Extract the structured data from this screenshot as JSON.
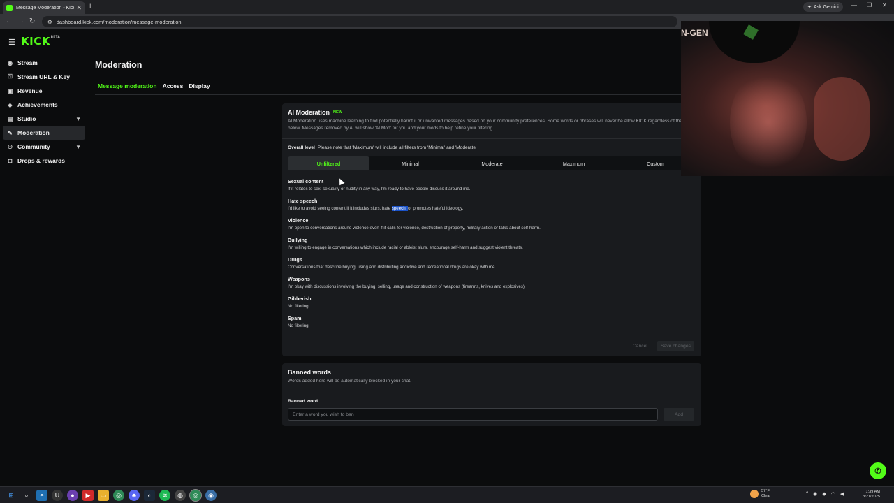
{
  "browser": {
    "tab_title": "Message Moderation - Kick Da",
    "new_tab": "+",
    "url": "dashboard.kick.com/moderation/message-moderation",
    "gemini_label": "Ask Gemini"
  },
  "app": {
    "brand": "KICK",
    "brand_tag": "BETA"
  },
  "sidebar": {
    "items": [
      {
        "label": "Stream",
        "icon": "broadcast-icon"
      },
      {
        "label": "Stream URL & Key",
        "icon": "link-icon"
      },
      {
        "label": "Revenue",
        "icon": "revenue-icon"
      },
      {
        "label": "Achievements",
        "icon": "achievements-icon"
      },
      {
        "label": "Studio",
        "icon": "studio-icon"
      },
      {
        "label": "Moderation",
        "icon": "wrench-icon"
      },
      {
        "label": "Community",
        "icon": "community-icon"
      },
      {
        "label": "Drops & rewards",
        "icon": "gift-icon"
      }
    ]
  },
  "page": {
    "title": "Moderation",
    "tabs": [
      "Message moderation",
      "Access",
      "Display"
    ]
  },
  "ai_moderation": {
    "title": "AI Moderation",
    "badge": "NEW",
    "description": "AI Moderation uses machine learning to find potentially harmful or unwanted messages based on your community preferences. Some words or phrases will never be allow KICK regardless of the settings below. Messages removed by AI will show 'AI Mod' for you and your mods to help refine your filtering.",
    "overall_label": "Overall level",
    "overall_note": "Please note that 'Maximum' will include all filters from 'Minimal' and 'Moderate'",
    "levels": [
      "Unfiltered",
      "Minimal",
      "Moderate",
      "Maximum",
      "Custom"
    ],
    "selected_level": "Unfiltered",
    "categories": [
      {
        "title": "Sexual content",
        "desc": "If it relates to sex, sexuality or nudity in any way, I'm ready to have people discuss it around me."
      },
      {
        "title": "Hate speech",
        "desc_pre": "I'd like to avoid seeing content if it includes slurs, hate ",
        "desc_hl": "speech, ",
        "desc_post": "or promotes hateful ideology."
      },
      {
        "title": "Violence",
        "desc": "I'm open to conversations around violence even if it calls for violence, destruction of property, military action or talks about self-harm."
      },
      {
        "title": "Bullying",
        "desc": "I'm willing to engage in conversations which include racial or ableist slurs, encourage self-harm and suggest violent threats."
      },
      {
        "title": "Drugs",
        "desc": "Conversations that describe buying, using and distributing addictive and recreational drugs are okay with me."
      },
      {
        "title": "Weapons",
        "desc": "I'm okay with discussions involving the buying, selling, usage and construction of weapons (firearms, knives and explosives)."
      },
      {
        "title": "Gibberish",
        "desc": "No filtering"
      },
      {
        "title": "Spam",
        "desc": "No filtering"
      }
    ],
    "cancel_label": "Cancel",
    "save_label": "Save changes"
  },
  "banned_words": {
    "title": "Banned words",
    "description": "Words added here will be automatically blocked in your chat.",
    "field_label": "Banned word",
    "placeholder": "Enter a word you wish to ban",
    "add_label": "Add"
  },
  "webcam": {
    "wall_text": "N-GEN"
  },
  "taskbar": {
    "weather_temp": "57°F",
    "weather_desc": "Clear",
    "time": "1:39 AM",
    "date": "3/21/2025"
  },
  "colors": {
    "accent": "#53fc18",
    "background": "#0b0c0d",
    "card": "#191b1e"
  }
}
